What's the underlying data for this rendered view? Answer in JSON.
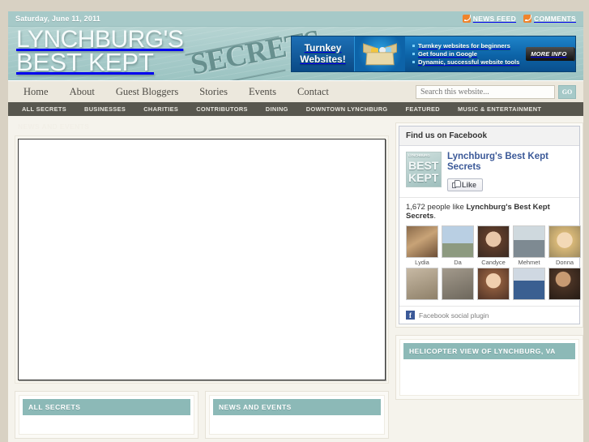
{
  "topbar": {
    "date": "Saturday, June 11, 2011",
    "links": [
      {
        "label": "NEWS FEED",
        "icon": "rss-icon"
      },
      {
        "label": "COMMENTS",
        "icon": "rss-icon"
      }
    ]
  },
  "masthead": {
    "logo_line1": "LYNCHBURG'S",
    "logo_line2": "BEST KEPT",
    "logo_stamp": "SECRETS"
  },
  "ad": {
    "title_line1": "Turnkey",
    "title_line2": "Websites!",
    "bullets": [
      "Turnkey websites for beginners",
      "Get found in Google",
      "Dynamic, successful website tools"
    ],
    "cta": "MORE INFO"
  },
  "mainnav": {
    "items": [
      {
        "label": "Home"
      },
      {
        "label": "About"
      },
      {
        "label": "Guest Bloggers"
      },
      {
        "label": "Stories"
      },
      {
        "label": "Events"
      },
      {
        "label": "Contact"
      }
    ]
  },
  "search": {
    "placeholder": "Search this website...",
    "value": "",
    "button": "GO"
  },
  "subnav": {
    "items": [
      {
        "label": "ALL SECRETS"
      },
      {
        "label": "BUSINESSES"
      },
      {
        "label": "CHARITIES"
      },
      {
        "label": "CONTRIBUTORS"
      },
      {
        "label": "DINING"
      },
      {
        "label": "DOWNTOWN LYNCHBURG"
      },
      {
        "label": "FEATURED"
      },
      {
        "label": "MUSIC & ENTERTAINMENT"
      }
    ]
  },
  "main": {
    "ghost_heading": "NEWS AND EVENTS"
  },
  "sidebar": {
    "facebook": {
      "header": "Find us on Facebook",
      "page_name": "Lynchburg's Best Kept Secrets",
      "like_button": "Like",
      "count_text_prefix": "1,672 people like ",
      "count_text_name": "Lynchburg's Best Kept Secrets",
      "count_text_suffix": ".",
      "logo_l1": "LYNCHBURG",
      "logo_l2": "BEST",
      "logo_l3": "KEPT",
      "faces_row1": [
        {
          "name": "Lydia"
        },
        {
          "name": "Da"
        },
        {
          "name": "Candyce"
        },
        {
          "name": "Mehmet"
        },
        {
          "name": "Donna"
        }
      ],
      "faces_row2": [
        {
          "name": ""
        },
        {
          "name": ""
        },
        {
          "name": ""
        },
        {
          "name": ""
        },
        {
          "name": ""
        }
      ],
      "footer": "Facebook social plugin"
    },
    "helicopter_widget": {
      "header": "HELICOPTER VIEW OF LYNCHBURG, VA"
    }
  },
  "bottom_widgets": [
    {
      "header": "ALL SECRETS"
    },
    {
      "header": "NEWS AND EVENTS"
    }
  ],
  "colors": {
    "page_bg": "#d8d1c3",
    "teal": "#a6c9c8",
    "widget_teal": "#8cb9b7",
    "subnav_dark": "#58574f",
    "nav_bg": "#ece8dd",
    "content_bg": "#f5f3ec",
    "rss_orange": "#f0842c",
    "fb_blue": "#3b5998",
    "ad_blue": "#0c63a7"
  }
}
